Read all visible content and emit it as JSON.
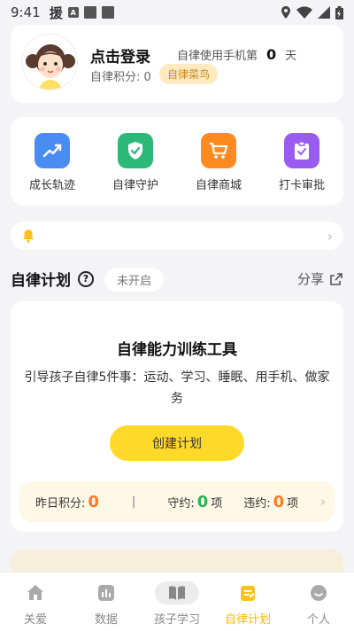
{
  "status_bar": {
    "time": "9:41",
    "app_char": "援",
    "a_icon": "A"
  },
  "profile": {
    "login_label": "点击登录",
    "phone_days_prefix": "自律使用手机第",
    "phone_days_value": "0",
    "phone_days_suffix": "天",
    "points_label": "自律积分: 0",
    "level_badge": "自律菜鸟"
  },
  "features": [
    {
      "label": "成长轨迹",
      "icon": "growth-chart-icon",
      "color": "#4a8cf2"
    },
    {
      "label": "自律守护",
      "icon": "shield-check-icon",
      "color": "#2cb978"
    },
    {
      "label": "自律商城",
      "icon": "shopping-cart-icon",
      "color": "#ff8a1f"
    },
    {
      "label": "打卡审批",
      "icon": "clipboard-check-icon",
      "color": "#9a5cf0"
    }
  ],
  "plan_section": {
    "title": "自律计划",
    "status": "未开启",
    "share_label": "分享"
  },
  "plan_card": {
    "title": "自律能力训练工具",
    "description": "引导孩子自律5件事：运动、学习、睡眠、用手机、做家务",
    "create_button": "创建计划",
    "stats": {
      "yesterday_label": "昨日积分:",
      "yesterday_value": "0",
      "separator": "|",
      "keep_label": "守约:",
      "keep_value": "0",
      "keep_unit": "项",
      "break_label": "违约:",
      "break_value": "0",
      "break_unit": "项"
    }
  },
  "tabs": [
    {
      "label": "关爱",
      "icon": "home-icon"
    },
    {
      "label": "数据",
      "icon": "data-chart-icon"
    },
    {
      "label": "孩子学习",
      "icon": "book-icon"
    },
    {
      "label": "自律计划",
      "icon": "plan-icon"
    },
    {
      "label": "个人",
      "icon": "profile-face-icon"
    }
  ],
  "colors": {
    "accent": "#ffd92a",
    "active_tab": "#ffb800"
  }
}
